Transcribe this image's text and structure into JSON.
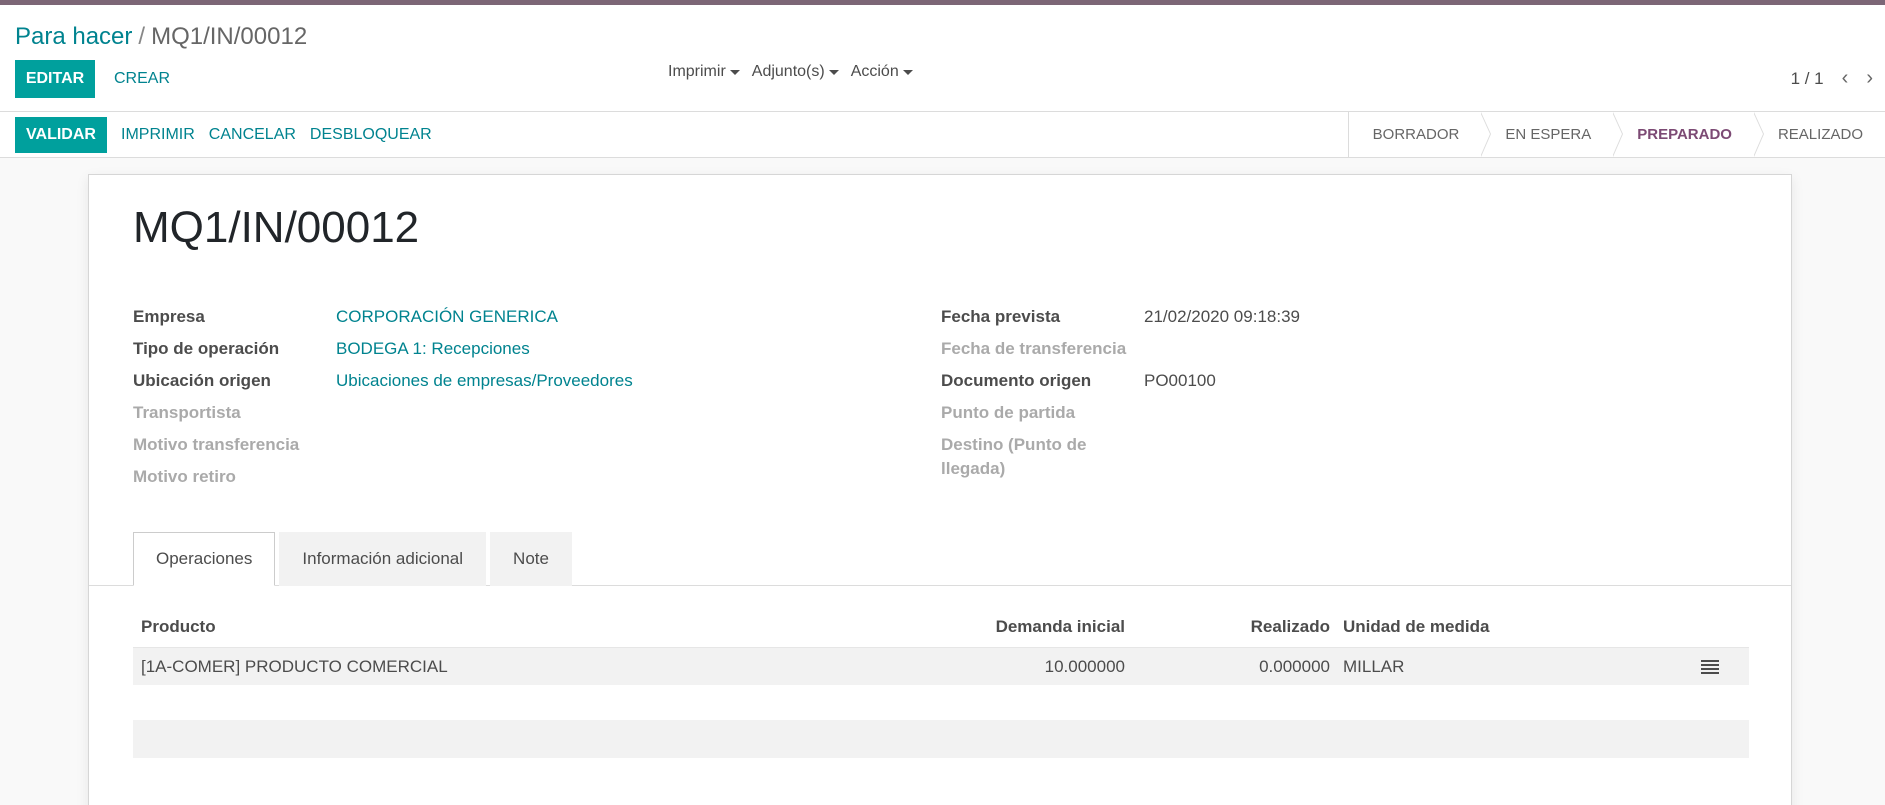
{
  "breadcrumb": {
    "parent": "Para hacer",
    "separator": "/",
    "current": "MQ1/IN/00012"
  },
  "control_panel": {
    "edit_label": "EDITAR",
    "create_label": "CREAR",
    "menus": [
      "Imprimir",
      "Adjunto(s)",
      "Acción"
    ],
    "pager": "1 / 1"
  },
  "statusbar": {
    "buttons": {
      "validate": "VALIDAR",
      "print": "IMPRIMIR",
      "cancel": "CANCELAR",
      "unlock": "DESBLOQUEAR"
    },
    "steps": [
      "BORRADOR",
      "EN ESPERA",
      "PREPARADO",
      "REALIZADO"
    ],
    "active_step": "PREPARADO"
  },
  "record": {
    "title": "MQ1/IN/00012",
    "left_fields": [
      {
        "label": "Empresa",
        "value": "CORPORACIÓN GENERICA"
      },
      {
        "label": "Tipo de operación",
        "value": "BODEGA 1: Recepciones"
      },
      {
        "label": "Ubicación origen",
        "value": "Ubicaciones de empresas/Proveedores"
      },
      {
        "label": "Transportista",
        "value": ""
      },
      {
        "label": "Motivo transferencia",
        "value": ""
      },
      {
        "label": "Motivo retiro",
        "value": ""
      }
    ],
    "right_fields": [
      {
        "label": "Fecha prevista",
        "value": "21/02/2020 09:18:39"
      },
      {
        "label": "Fecha de transferencia",
        "value": ""
      },
      {
        "label": "Documento origen",
        "value": "PO00100"
      },
      {
        "label": "Punto de partida",
        "value": ""
      },
      {
        "label": "Destino (Punto de llegada)",
        "value": ""
      }
    ]
  },
  "tabs": [
    "Operaciones",
    "Información adicional",
    "Note"
  ],
  "operations": {
    "headers": {
      "product": "Producto",
      "demand": "Demanda inicial",
      "done": "Realizado",
      "uom": "Unidad de medida"
    },
    "rows": [
      {
        "product": "[1A-COMER] PRODUCTO COMERCIAL",
        "demand": "10.000000",
        "done": "0.000000",
        "uom": "MILLAR"
      }
    ]
  },
  "colors": {
    "accent": "#7c6676",
    "primary": "#00a09d",
    "link": "#00838f",
    "active_step": "#7c4a74"
  },
  "icons": {
    "pager_prev": "chevron-left-icon",
    "pager_next": "chevron-right-icon",
    "row_detail": "list-icon",
    "dropdown": "caret-down-icon"
  }
}
